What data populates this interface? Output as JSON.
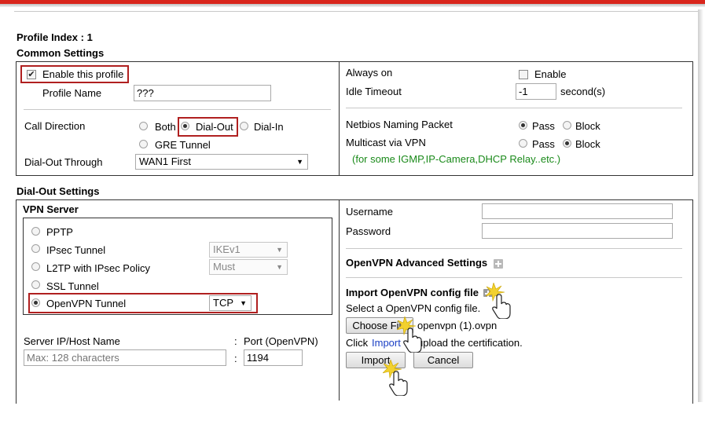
{
  "profile_index": "Profile Index : 1",
  "common_settings": {
    "heading": "Common Settings",
    "enable_label": "Enable this profile",
    "enable_checked": true,
    "profile_name_label": "Profile Name",
    "profile_name_value": "???",
    "call_direction_label": "Call Direction",
    "call_direction_options": [
      "Both",
      "Dial-Out",
      "Dial-In",
      "GRE Tunnel"
    ],
    "call_direction_selected": "Dial-Out",
    "dial_out_through_label": "Dial-Out Through",
    "dial_out_through_value": "WAN1 First",
    "always_on_label": "Always on",
    "always_on_enable_label": "Enable",
    "idle_timeout_label": "Idle Timeout",
    "idle_timeout_value": "-1",
    "idle_timeout_unit": "second(s)",
    "netbios_label": "Netbios Naming Packet",
    "netbios_selected": "Pass",
    "multicast_label": "Multicast via VPN",
    "multicast_selected": "Block",
    "pass_label": "Pass",
    "block_label": "Block",
    "multicast_note": "(for some IGMP,IP-Camera,DHCP Relay..etc.)"
  },
  "dial_out_settings": {
    "heading": "Dial-Out Settings",
    "vpn_server_label": "VPN Server",
    "vpn_options": [
      "PPTP",
      "IPsec Tunnel",
      "L2TP with IPsec Policy",
      "SSL Tunnel",
      "OpenVPN Tunnel"
    ],
    "vpn_selected": "OpenVPN Tunnel",
    "ipsec_select": "IKEv1",
    "l2tp_select": "Must",
    "openvpn_select": "TCP",
    "server_label": "Server IP/Host Name",
    "server_placeholder": "Max: 128 characters",
    "colon": ":",
    "port_label": "Port (OpenVPN)",
    "port_value": "1194",
    "username_label": "Username",
    "username_value": "",
    "password_label": "Password",
    "password_value": "",
    "advanced_label": "OpenVPN Advanced Settings",
    "import_heading": "Import OpenVPN config file",
    "import_hint": "Select a OpenVPN config file.",
    "choose_file_label": "Choose File",
    "file_name": "openvpn (1).ovpn",
    "click_text": "Click",
    "import_link": "Import",
    "upload_text": "upload the certification.",
    "import_button": "Import",
    "cancel_button": "Cancel"
  },
  "colors": {
    "accent_red": "#d9261c",
    "highlight_box": "#b02020",
    "note_green": "#1a8a1a",
    "link_blue": "#1a3fc4"
  }
}
